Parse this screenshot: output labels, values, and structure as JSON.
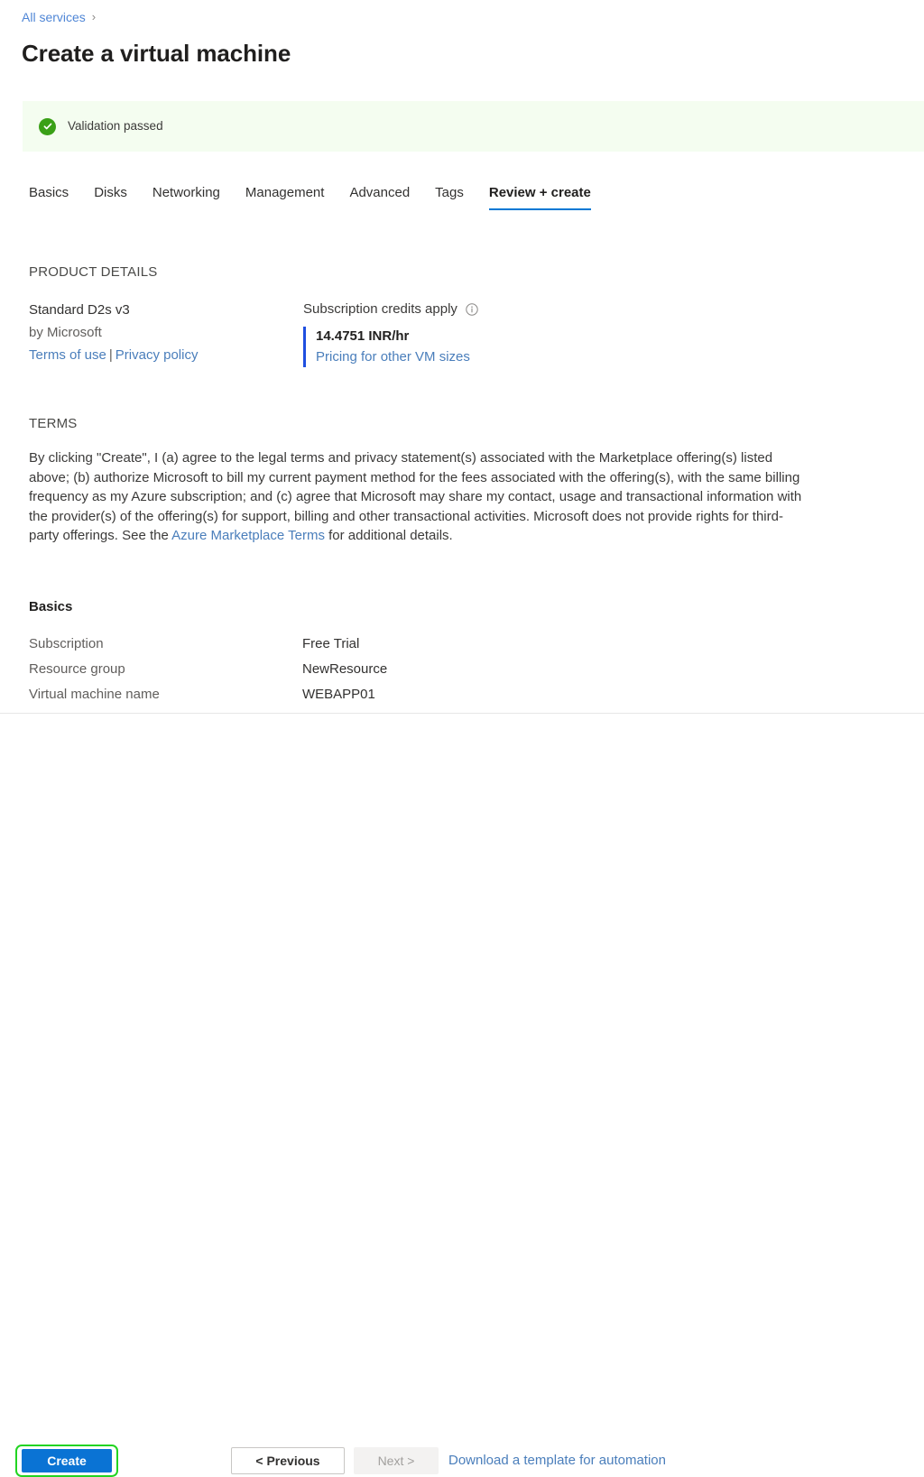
{
  "breadcrumb": {
    "link_label": "All services",
    "chevron": "›"
  },
  "page_title": "Create a virtual machine",
  "validation": {
    "icon": "check-circle-icon",
    "message": "Validation passed",
    "background_color": "#f4fdf0",
    "icon_color": "#3aa017"
  },
  "tabs": [
    {
      "label": "Basics",
      "active": false
    },
    {
      "label": "Disks",
      "active": false
    },
    {
      "label": "Networking",
      "active": false
    },
    {
      "label": "Management",
      "active": false
    },
    {
      "label": "Advanced",
      "active": false
    },
    {
      "label": "Tags",
      "active": false
    },
    {
      "label": "Review + create",
      "active": true
    }
  ],
  "product_details": {
    "heading": "PRODUCT DETAILS",
    "name": "Standard D2s v3",
    "publisher": "by Microsoft",
    "terms_of_use_label": "Terms of use",
    "separator": "|",
    "privacy_policy_label": "Privacy policy",
    "credits_label": "Subscription credits apply",
    "info_icon": "info-circle-icon",
    "price": "14.4751 INR/hr",
    "pricing_link_label": "Pricing for other VM sizes",
    "accent_color": "#1f4fe0"
  },
  "terms": {
    "heading": "TERMS",
    "text_before_link": "By clicking \"Create\", I (a) agree to the legal terms and privacy statement(s) associated with the Marketplace offering(s) listed above; (b) authorize Microsoft to bill my current payment method for the fees associated with the offering(s), with the same billing frequency as my Azure subscription; and (c) agree that Microsoft may share my contact, usage and transactional information with the provider(s) of the offering(s) for support, billing and other transactional activities. Microsoft does not provide rights for third-party offerings. See the ",
    "link_label": "Azure Marketplace Terms",
    "text_after_link": " for additional details."
  },
  "basics": {
    "heading": "Basics",
    "rows": [
      {
        "label": "Subscription",
        "value": "Free Trial"
      },
      {
        "label": "Resource group",
        "value": "NewResource"
      },
      {
        "label": "Virtual machine name",
        "value": "WEBAPP01"
      }
    ]
  },
  "footer": {
    "create_label": "Create",
    "previous_label": "< Previous",
    "next_label": "Next >",
    "download_label": "Download a template for automation",
    "create_color": "#0a73d4",
    "highlight_color": "#22d422"
  }
}
